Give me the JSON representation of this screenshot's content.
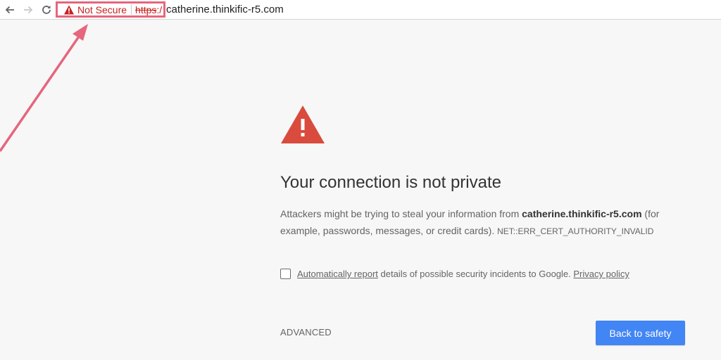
{
  "browser": {
    "back_icon": "arrow-left-icon",
    "forward_icon": "arrow-right-icon",
    "reload_icon": "reload-icon",
    "security_chip": {
      "icon": "warning-triangle-icon",
      "label": "Not Secure",
      "scheme": "https",
      "scheme_suffix": ":/",
      "color": "#c5221f"
    },
    "url_host": "catherine.thinkific-r5.com"
  },
  "annotation": {
    "highlight_color": "#e5667d"
  },
  "interstitial": {
    "icon": "warning-triangle-icon",
    "icon_color": "#d94b3d",
    "heading": "Your connection is not private",
    "body_prefix": "Attackers might be trying to steal your information from ",
    "body_host": "catherine.thinkific-r5.com",
    "body_suffix": " (for example, passwords, messages, or credit cards).",
    "error_code": "NET::ERR_CERT_AUTHORITY_INVALID",
    "report": {
      "checked": false,
      "link1": "Automatically report",
      "middle": " details of possible security incidents to Google. ",
      "link2": "Privacy policy"
    },
    "advanced_label": "ADVANCED",
    "primary_label": "Back to safety",
    "primary_color": "#4285f4"
  }
}
